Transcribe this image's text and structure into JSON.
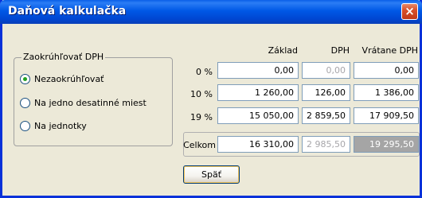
{
  "window": {
    "title": "Daňová kalkulačka",
    "close_label": "×"
  },
  "rounding": {
    "title": "Zaokrúhľovať DPH",
    "options": [
      {
        "label": "Nezaokrúhľovať",
        "checked": true
      },
      {
        "label": "Na jedno desatinné miest",
        "checked": false
      },
      {
        "label": "Na jednotky",
        "checked": false
      }
    ]
  },
  "table": {
    "columns": [
      "Základ",
      "DPH",
      "Vrátane DPH"
    ],
    "rows": [
      {
        "label": "0 %",
        "base": "0,00",
        "vat": "0,00",
        "total": "0,00"
      },
      {
        "label": "10 %",
        "base": "1 260,00",
        "vat": "126,00",
        "total": "1 386,00"
      },
      {
        "label": "19 %",
        "base": "15 050,00",
        "vat": "2 859,50",
        "total": "17 909,50"
      }
    ],
    "sum": {
      "label": "Celkom",
      "base": "16 310,00",
      "vat": "2 985,50",
      "total": "19 295,50"
    }
  },
  "buttons": {
    "back": "Späť"
  }
}
